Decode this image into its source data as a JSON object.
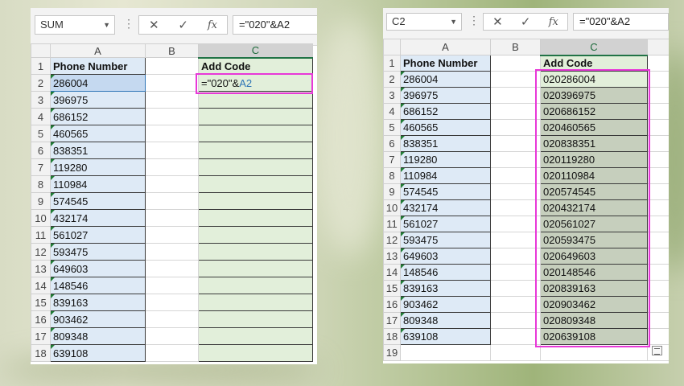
{
  "left": {
    "name_box": "SUM",
    "formula": "=\"020\"&A2",
    "formula_parts": {
      "text": "=\"020\"&",
      "ref": "A2"
    },
    "columns": [
      "A",
      "B",
      "C"
    ],
    "headers": {
      "a": "Phone Number",
      "c": "Add Code"
    },
    "rows": [
      "1",
      "2",
      "3",
      "4",
      "5",
      "6",
      "7",
      "8",
      "9",
      "10",
      "11",
      "12",
      "13",
      "14",
      "15",
      "16",
      "17",
      "18"
    ],
    "phones": [
      "286004",
      "396975",
      "686152",
      "460565",
      "838351",
      "119280",
      "110984",
      "574545",
      "432174",
      "561027",
      "593475",
      "649603",
      "148546",
      "839163",
      "903462",
      "809348",
      "639108"
    ]
  },
  "right": {
    "name_box": "C2",
    "formula": "=\"020\"&A2",
    "columns": [
      "A",
      "B",
      "C"
    ],
    "headers": {
      "a": "Phone Number",
      "c": "Add Code"
    },
    "rows": [
      "1",
      "2",
      "3",
      "4",
      "5",
      "6",
      "7",
      "8",
      "9",
      "10",
      "11",
      "12",
      "13",
      "14",
      "15",
      "16",
      "17",
      "18",
      "19"
    ],
    "phones": [
      "286004",
      "396975",
      "686152",
      "460565",
      "838351",
      "119280",
      "110984",
      "574545",
      "432174",
      "561027",
      "593475",
      "649603",
      "148546",
      "839163",
      "903462",
      "809348",
      "639108"
    ],
    "results": [
      "020286004",
      "020396975",
      "020686152",
      "020460565",
      "020838351",
      "020119280",
      "020110984",
      "020574545",
      "020432174",
      "020561027",
      "020593475",
      "020649603",
      "020148546",
      "020839163",
      "020903462",
      "020809348",
      "020639108"
    ]
  },
  "icons": {
    "cancel": "✕",
    "enter": "✓",
    "function": "fx"
  },
  "colors": {
    "highlight": "#e838d8",
    "phone_fill": "#deeaf6",
    "code_fill": "#e2efda",
    "selected_fill": "#c6cfbd"
  }
}
